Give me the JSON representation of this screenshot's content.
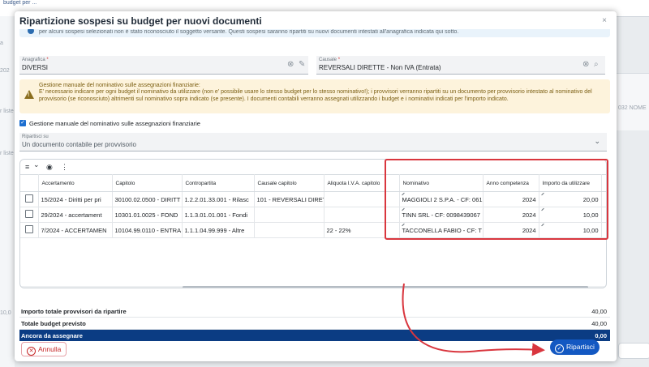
{
  "background": {
    "top_tab": "budget per ...",
    "left_labels": [
      "a",
      "202",
      "r liste",
      "r liste",
      "10,0"
    ],
    "right_label": "032 NOME"
  },
  "modal": {
    "title": "Ripartizione sospesi su budget per nuovi documenti",
    "close_label": "×",
    "info_text": "per alcuni sospesi selezionati non è stato riconosciuto il soggetto versante. Questi sospesi saranno ripartiti su nuovi documenti intestati all'anagrafica indicata qui sotto."
  },
  "fields": {
    "anagrafica": {
      "label": "Anagrafica",
      "value": "DIVERSI"
    },
    "causale": {
      "label": "Causale",
      "value": "REVERSALI DIRETTE - Non IVA (Entrata)"
    }
  },
  "warning": {
    "title": "Gestione manuale del nominativo sulle assegnazioni finanziarie:",
    "body": "E' necessario indicare per ogni budget il nominativo da utilizzare (non e' possibile usare lo stesso budget per lo stesso nominativo!); i provvisori verranno ripartiti su un documento per provvisorio intestato al nominativo del provvisorio (se riconosciuto) altrimenti sul nominativo sopra indicato (se presente). I documenti contabili verranno assegnati utilizzando i budget e i nominativi indicati per l'importo indicato."
  },
  "checkbox": {
    "label": "Gestione manuale del nominativo sulle assegnazioni finanziarie",
    "checked": true
  },
  "ripartisci_su": {
    "label": "Ripartisci su",
    "value": "Un documento contabile per provvisorio"
  },
  "grid": {
    "toolbar": {
      "menu_icon": "≡",
      "menu_chev": "⌄",
      "eye_icon": "◉",
      "more_icon": "⋮"
    },
    "columns": [
      "",
      "Accertamento",
      "Capitolo",
      "Contropartita",
      "Causale capitolo",
      "Aliquota I.V.A. capitolo",
      "Nominativo",
      "Anno competenza",
      "Importo da utilizzare"
    ],
    "rows": [
      [
        "15/2024 - Diritti per pri",
        "30100.02.0500 - DIRITT",
        "1.2.2.01.33.001 - Rilasc",
        "101 - REVERSALI DIRET",
        "",
        "MAGGIOLI 2 S.P.A. - CF: 061",
        "2024",
        "20,00"
      ],
      [
        "29/2024 - accertament",
        "10301.01.0025 - FOND",
        "1.1.3.01.01.001 - Fondi",
        "",
        "",
        "TINN SRL - CF: 0098439067",
        "2024",
        "10,00"
      ],
      [
        "7/2024 - ACCERTAMEN",
        "10104.99.0110 - ENTRA",
        "1.1.1.04.99.999 - Altre",
        "",
        "22 - 22%",
        "TACCONELLA FABIO - CF: T",
        "2024",
        "10,00"
      ]
    ]
  },
  "totals": [
    {
      "label": "Importo totale provvisori da ripartire",
      "value": "40,00"
    },
    {
      "label": "Totale budget previsto",
      "value": "40,00"
    },
    {
      "label": "Ancora da assegnare",
      "value": "0,00"
    }
  ],
  "buttons": {
    "annulla": "Annulla",
    "ripartisci": "Ripartisci"
  },
  "colors": {
    "primary": "#1358c2",
    "total_bar": "#0b3c83",
    "annotation_red": "#d9363e",
    "warning_bg": "#fdf3dc"
  }
}
